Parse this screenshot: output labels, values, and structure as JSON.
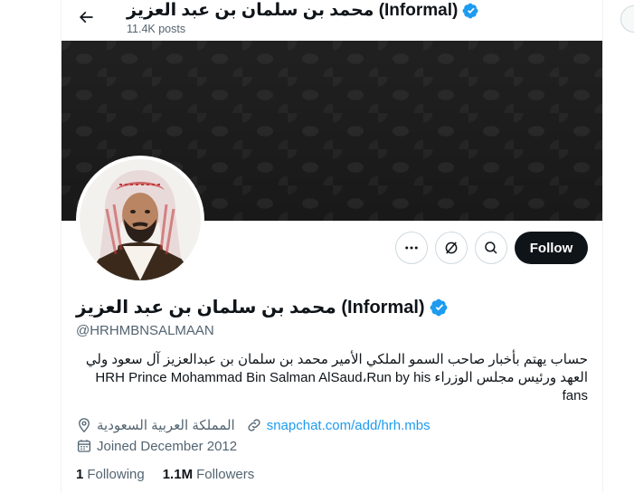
{
  "header": {
    "title": "محمد بن سلمان بن عبد العزيز (Informal)",
    "posts_count": "11.4K posts"
  },
  "profile": {
    "display_name": "محمد بن سلمان بن عبد العزيز (Informal)",
    "handle": "@HRHMBNSALMAAN",
    "bio_line1": "حساب يهتم بأخبار صاحب السمو الملكي الأمير محمد بن سلمان بن عبدالعزيز آل سعود ولي",
    "bio_line2": "العهد ورئيس مجلس الوزراء  HRH Prince Mohammad Bin Salman AlSaud،Run by his",
    "bio_line3": "fans",
    "location": "المملكة العربية السعودية",
    "website": "snapchat.com/add/hrh.mbs",
    "joined": "Joined December 2012",
    "following_count": "1",
    "following_label": "Following",
    "followers_count": "1.1M",
    "followers_label": "Followers"
  },
  "actions": {
    "follow_label": "Follow"
  },
  "colors": {
    "accent": "#1d9bf0",
    "follow_bg": "#0f1419",
    "muted_text": "#536471"
  }
}
